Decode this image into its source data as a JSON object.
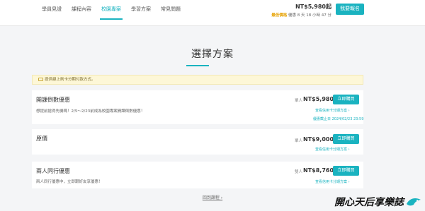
{
  "nav": {
    "items": [
      {
        "label": "學員見證"
      },
      {
        "label": "課程內容"
      },
      {
        "label": "校園專案"
      },
      {
        "label": "學習方案"
      },
      {
        "label": "常見問題"
      }
    ],
    "active_index": 2
  },
  "header": {
    "total_price": "NT$5,980起",
    "countdown_tag": "最低價格",
    "countdown_text": " 優惠 8 天 18 小時 47 分",
    "signup_label": "我要報名"
  },
  "section": {
    "title": "選擇方案"
  },
  "notice": {
    "text": "提供線上刷卡分期付款方式。"
  },
  "plans": [
    {
      "name": "開課倒數優惠",
      "desc": "想提前搶得先機嗎！2/5～2/23前成為校園專案開課倒數優惠！",
      "unit": "單人",
      "price": "NT$5,980",
      "buy_label": "立即購買",
      "install_label": "查看信用卡分期方案 ›",
      "deadline": "優惠截止日 2024/02/23 23:59"
    },
    {
      "name": "原價",
      "desc": "",
      "unit": "單人",
      "price": "NT$9,000",
      "buy_label": "立即購買",
      "install_label": "查看信用卡分期方案 ›",
      "deadline": ""
    },
    {
      "name": "兩人同行優惠",
      "desc": "兩人同行優惠中，立即跟好友享優惠！",
      "unit": "雙人",
      "price": "NT$8,760",
      "buy_label": "立即購買",
      "install_label": "查看信用卡分期方案 ›",
      "deadline": ""
    }
  ],
  "footer": {
    "more_link": "回到課程 ›"
  },
  "watermark": {
    "text": "開心天后享樂誌"
  },
  "colors": {
    "accent": "#1ab3c0",
    "notice_bg": "#fdf7d7",
    "countdown_tag": "#e6a100"
  }
}
